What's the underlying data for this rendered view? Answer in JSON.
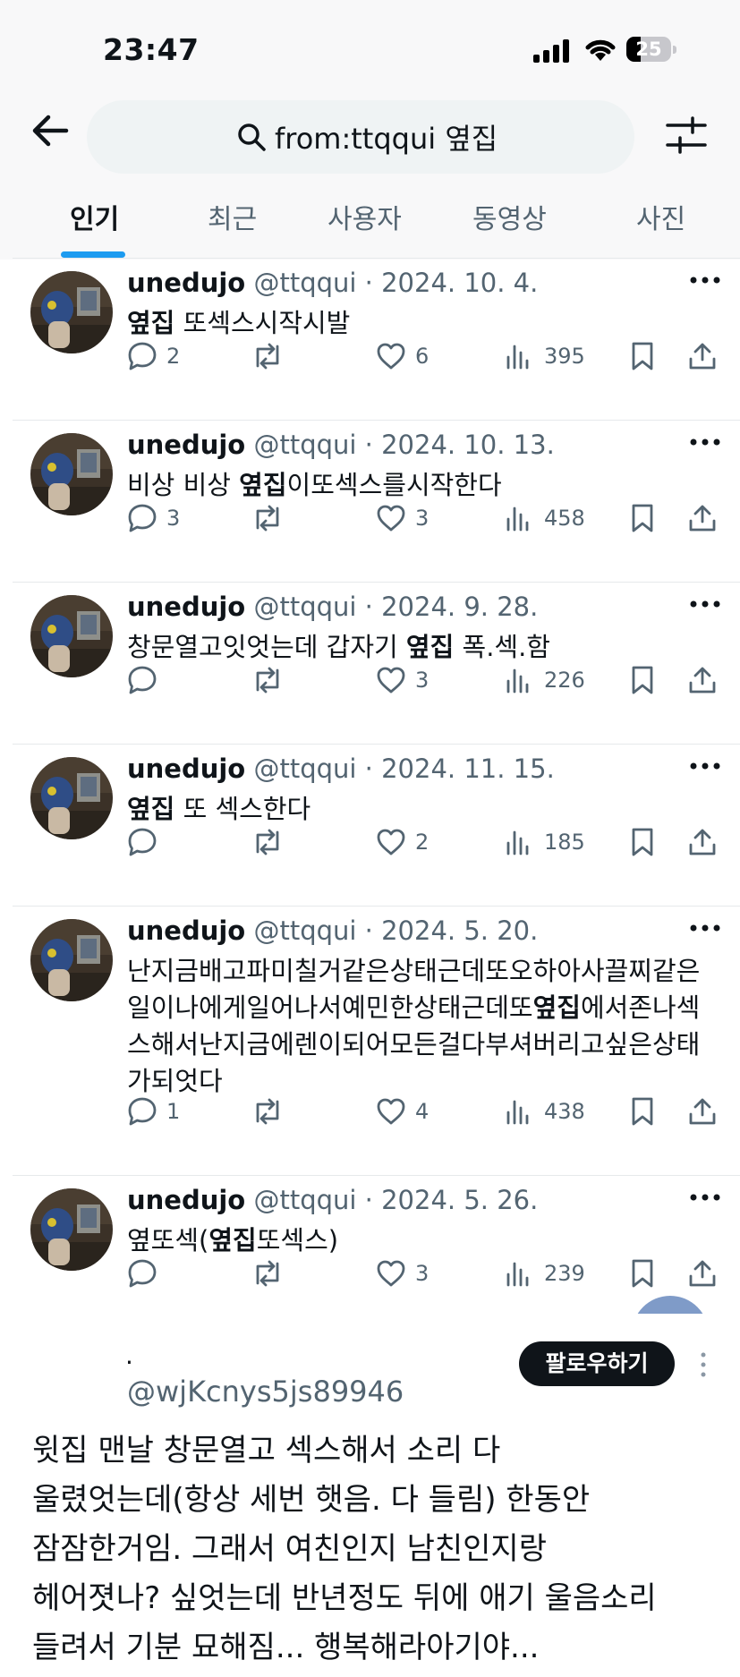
{
  "status_bar": {
    "time": "23:47",
    "battery": "25"
  },
  "search": {
    "query": "from:ttqqui 옆집"
  },
  "tabs": [
    {
      "label": "인기",
      "active": true
    },
    {
      "label": "최근"
    },
    {
      "label": "사용자"
    },
    {
      "label": "동영상"
    },
    {
      "label": "사진"
    }
  ],
  "tweets": [
    {
      "name": "unedujo",
      "meta": " @ttqqui · 2024. 10. 4.",
      "parts": [
        {
          "t": "옆집",
          "b": true
        },
        {
          "t": " 또섹스시작시발"
        }
      ],
      "replies": "2",
      "likes": "6",
      "views": "395"
    },
    {
      "name": "unedujo",
      "meta": " @ttqqui · 2024. 10. 13.",
      "parts": [
        {
          "t": "비상 비상 "
        },
        {
          "t": "옆집",
          "b": true
        },
        {
          "t": "이또섹스를시작한다"
        }
      ],
      "replies": "3",
      "likes": "3",
      "views": "458"
    },
    {
      "name": "unedujo",
      "meta": " @ttqqui · 2024. 9. 28.",
      "parts": [
        {
          "t": "창문열고잇엇는데 갑자기 "
        },
        {
          "t": "옆집",
          "b": true
        },
        {
          "t": " 폭.섹.함"
        }
      ],
      "replies": "",
      "likes": "3",
      "views": "226"
    },
    {
      "name": "unedujo",
      "meta": " @ttqqui · 2024. 11. 15.",
      "parts": [
        {
          "t": "옆집",
          "b": true
        },
        {
          "t": " 또 섹스한다"
        }
      ],
      "replies": "",
      "likes": "2",
      "views": "185"
    },
    {
      "name": "unedujo",
      "meta": " @ttqqui · 2024. 5. 20.",
      "parts": [
        {
          "t": "난지금배고파미칠거같은상태근데또오하아사끌찌같은\n일이나에게일어나서예민한상태근데또"
        },
        {
          "t": "옆집",
          "b": true
        },
        {
          "t": "에서존나섹\n스해서난지금에렌이되어모든걸다부셔버리고싶은상태\n가되엇다"
        }
      ],
      "replies": "1",
      "likes": "4",
      "views": "438"
    },
    {
      "name": "unedujo",
      "meta": " @ttqqui · 2024. 5. 26.",
      "parts": [
        {
          "t": "옆또섹("
        },
        {
          "t": "옆집",
          "b": true
        },
        {
          "t": "또섹스)"
        }
      ],
      "replies": "",
      "likes": "3",
      "views": "239"
    }
  ],
  "embedded_post": {
    "dot": "·",
    "handle": "@wjKcnys5js89946",
    "follow_label": "팔로우하기",
    "text": "윗집 맨날 창문열고 섹스해서 소리 다\n울렸엇는데(항상 세번 햇음. 다 들림) 한동안\n잠잠한거임. 그래서 여친인지 남친인지랑\n헤어졋나? 싶엇는데 반년정도 뒤에 애기 울음소리\n들려서 기분 묘해짐... 행복해라아기야..."
  },
  "colors": {
    "accent": "#1d9bf0",
    "text": "#0f1419",
    "secondary": "#536471",
    "follow_button": "#0f1419"
  }
}
